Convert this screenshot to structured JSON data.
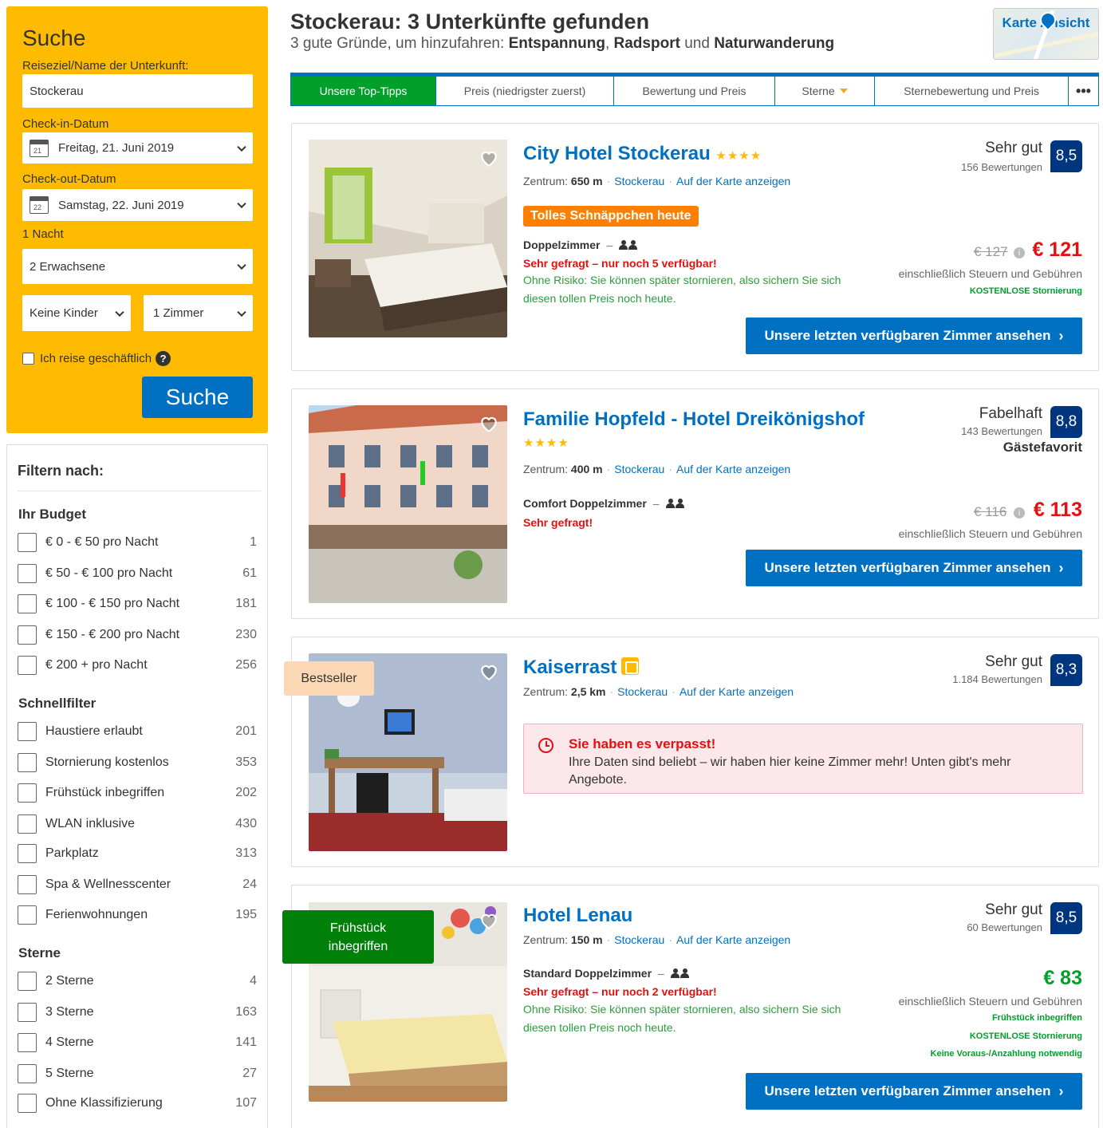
{
  "search": {
    "title": "Suche",
    "destination_label": "Reiseziel/Name der Unterkunft:",
    "destination_value": "Stockerau",
    "checkin_label": "Check-in-Datum",
    "checkin_value": "Freitag, 21. Juni 2019",
    "checkin_day": "21",
    "checkout_label": "Check-out-Datum",
    "checkout_value": "Samstag, 22. Juni 2019",
    "checkout_day": "22",
    "nights": "1 Nacht",
    "adults": "2 Erwachsene",
    "children": "Keine Kinder",
    "rooms": "1 Zimmer",
    "business_label": "Ich reise geschäftlich",
    "help_glyph": "?",
    "button": "Suche"
  },
  "filters": {
    "title": "Filtern nach:",
    "budget": {
      "title": "Ihr Budget",
      "items": [
        {
          "label": "€ 0 - € 50 pro Nacht",
          "count": "1"
        },
        {
          "label": "€ 50 - € 100 pro Nacht",
          "count": "61"
        },
        {
          "label": "€ 100 - € 150 pro Nacht",
          "count": "181"
        },
        {
          "label": "€ 150 - € 200 pro Nacht",
          "count": "230"
        },
        {
          "label": "€ 200 + pro Nacht",
          "count": "256"
        }
      ]
    },
    "quick": {
      "title": "Schnellfilter",
      "items": [
        {
          "label": "Haustiere erlaubt",
          "count": "201"
        },
        {
          "label": "Stornierung kostenlos",
          "count": "353"
        },
        {
          "label": "Frühstück inbegriffen",
          "count": "202"
        },
        {
          "label": "WLAN inklusive",
          "count": "430"
        },
        {
          "label": "Parkplatz",
          "count": "313"
        },
        {
          "label": "Spa & Wellnesscenter",
          "count": "24"
        },
        {
          "label": "Ferienwohnungen",
          "count": "195"
        }
      ]
    },
    "stars": {
      "title": "Sterne",
      "items": [
        {
          "label": "2 Sterne",
          "count": "4"
        },
        {
          "label": "3 Sterne",
          "count": "163"
        },
        {
          "label": "4 Sterne",
          "count": "141"
        },
        {
          "label": "5 Sterne",
          "count": "27"
        },
        {
          "label": "Ohne Klassifizierung",
          "count": "107"
        }
      ]
    }
  },
  "header": {
    "title": "Stockerau: 3 Unterkünfte gefunden",
    "sub_prefix": "3 gute Gründe, um hinzufahren: ",
    "reason1": "Entspannung",
    "sep1": ", ",
    "reason2": "Radsport",
    "sep2": " und ",
    "reason3": "Naturwanderung",
    "map_label": "Karte Ansicht"
  },
  "tabs": {
    "top": "Unsere Top-Tipps",
    "price": "Preis (niedrigster zuerst)",
    "rating_price": "Bewertung und Preis",
    "stars": "Sterne",
    "star_rating_price": "Sternebewertung und Preis",
    "more": "•••"
  },
  "common": {
    "location_prefix": "Zentrum:",
    "town": "Stockerau",
    "map_link": "Auf der Karte anzeigen",
    "dot": "·",
    "dash": "–",
    "tax_note": "einschließlich Steuern und Gebühren",
    "cta": "Unsere letzten verfügbaren Zimmer ansehen",
    "cta_arrow": "›",
    "info_glyph": "i",
    "no_risk": "Ohne Risiko: Sie können später stornieren, also sichern Sie sich diesen tollen Preis noch heute."
  },
  "hotels": [
    {
      "name": "City Hotel Stockerau",
      "stars": "★★★★",
      "distance": "650 m",
      "rating_word": "Sehr gut",
      "reviews": "156 Bewertungen",
      "score": "8,5",
      "badge": "Tolles Schnäppchen heute",
      "room": "Doppelzimmer",
      "urgent": "Sehr gefragt – nur noch 5 verfügbar!",
      "old_price": "€ 127",
      "price": "€ 121",
      "perk1": "KOSTENLOSE Stornierung"
    },
    {
      "name": "Familie Hopfeld - Hotel Dreikönigshof",
      "stars": "★★★★",
      "distance": "400 m",
      "rating_word": "Fabelhaft",
      "reviews": "143 Bewertungen",
      "score": "8,8",
      "fav": "Gästefavorit",
      "room": "Comfort Doppelzimmer",
      "urgent": "Sehr gefragt!",
      "old_price": "€ 116",
      "price": "€ 113"
    },
    {
      "name": "Kaiserrast",
      "distance": "2,5 km",
      "rating_word": "Sehr gut",
      "reviews": "1.184 Bewertungen",
      "score": "8,3",
      "ribbon": "Bestseller",
      "alert_title": "Sie haben es verpasst!",
      "alert_text": "Ihre Daten sind beliebt – wir haben hier keine Zimmer mehr! Unten gibt's mehr Angebote."
    },
    {
      "name": "Hotel Lenau",
      "distance": "150 m",
      "rating_word": "Sehr gut",
      "reviews": "60 Bewertungen",
      "score": "8,5",
      "ribbon": "Frühstück inbegriffen",
      "room": "Standard Doppelzimmer",
      "urgent": "Sehr gefragt – nur noch 2 verfügbar!",
      "price": "€ 83",
      "perk1": "Frühstück inbegriffen",
      "perk2": "KOSTENLOSE Stornierung",
      "perk3": "Keine Voraus-/Anzahlung notwendig"
    }
  ],
  "colors": {
    "brand_yellow": "#febb02",
    "brand_blue": "#0071c2",
    "score_navy": "#003580",
    "active_tab_green": "#00a02a",
    "price_red": "#e21111"
  }
}
